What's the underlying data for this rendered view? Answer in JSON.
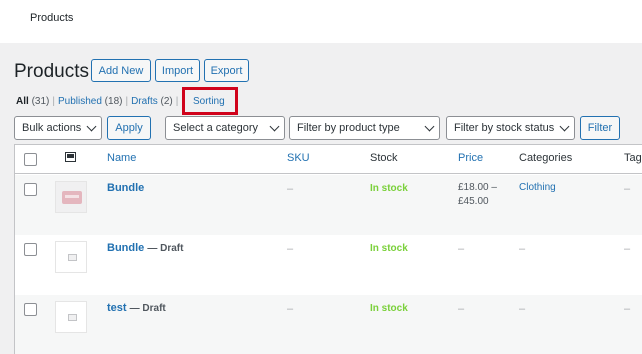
{
  "topbar": {
    "title": "Products"
  },
  "header": {
    "title": "Products",
    "add_new": "Add New",
    "import": "Import",
    "export": "Export"
  },
  "views": {
    "all": {
      "label": "All",
      "count": "(31)"
    },
    "published": {
      "label": "Published",
      "count": "(18)"
    },
    "drafts": {
      "label": "Drafts",
      "count": "(2)"
    },
    "sorting": "Sorting"
  },
  "filters": {
    "bulk_actions": "Bulk actions",
    "apply": "Apply",
    "category": "Select a category",
    "product_type": "Filter by product type",
    "stock_status": "Filter by stock status",
    "filter": "Filter"
  },
  "columns": {
    "name": "Name",
    "sku": "SKU",
    "stock": "Stock",
    "price": "Price",
    "categories": "Categories",
    "tags": "Tags"
  },
  "rows": [
    {
      "name": "Bundle",
      "draft": "",
      "sku": "–",
      "stock": "In stock",
      "price_line1": "£18.00 –",
      "price_line2": "£45.00",
      "categories": "Clothing",
      "tags": "–"
    },
    {
      "name": "Bundle",
      "draft": "— Draft",
      "sku": "–",
      "stock": "In stock",
      "price": "–",
      "categories": "–",
      "tags": "–"
    },
    {
      "name": "test",
      "draft": "— Draft",
      "sku": "–",
      "stock": "In stock",
      "price": "–",
      "categories": "–",
      "tags": "–"
    }
  ],
  "colors": {
    "accent": "#2271b1",
    "instock": "#7ad03a",
    "highlight": "#d0021b"
  }
}
